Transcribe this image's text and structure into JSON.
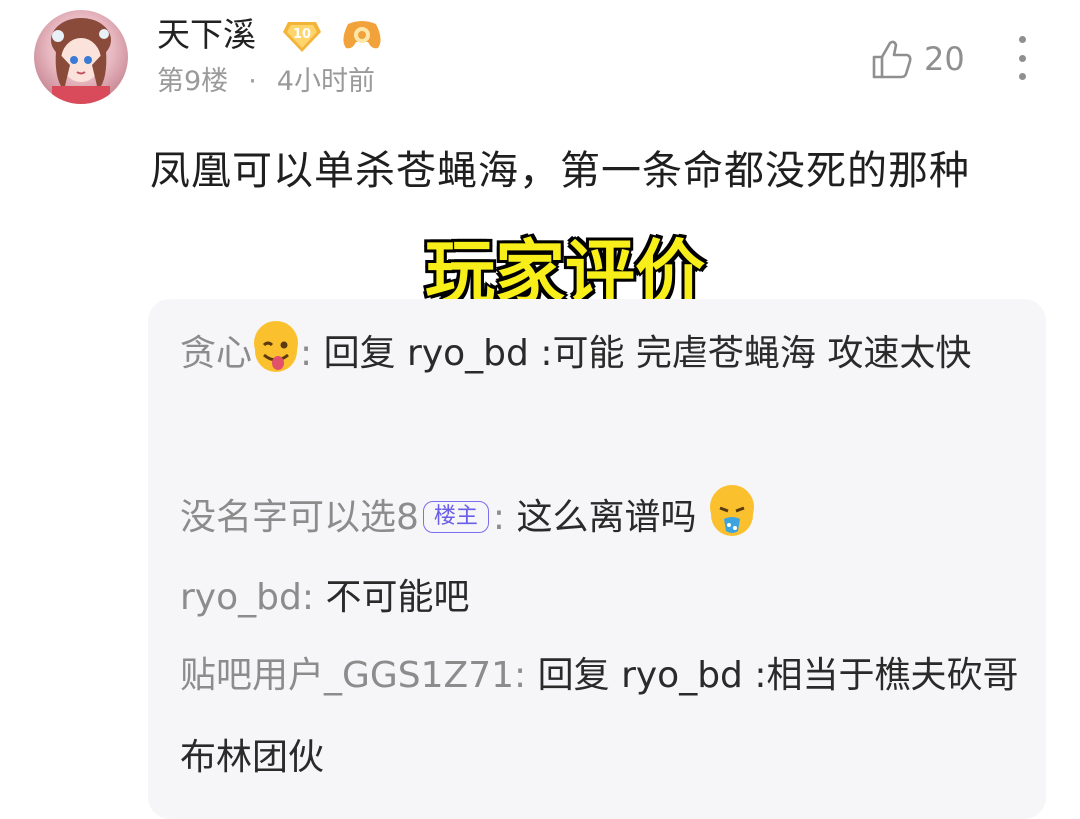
{
  "post": {
    "author": "天下溪",
    "level": "10",
    "floor": "第9楼",
    "separator": "·",
    "time": "4小时前",
    "like_count": "20",
    "content": "凤凰可以单杀苍蝇海，第一条命都没死的那种"
  },
  "overlay_title": "玩家评价",
  "replies": [
    {
      "name": "贪心",
      "sep": ":",
      "text": "回复 ryo_bd :可能 完虐苍蝇海 攻速太快",
      "emoji": "winking-tongue-emoji"
    },
    {
      "name": "没名字可以选8",
      "tag": "楼主",
      "sep": ":",
      "text": "这么离谱吗",
      "emoji": "vomiting-face-emoji"
    },
    {
      "name": "ryo_bd",
      "sep": ":",
      "text": "不可能吧"
    },
    {
      "name": "贴吧用户_GGS1Z71",
      "sep": ":",
      "text": "回复 ryo_bd :相当于樵夫砍哥布林团伙"
    }
  ],
  "colors": {
    "overlay_fill": "#f8ee1a",
    "tag_border": "#7b6ff0",
    "reply_bg": "#f6f6f8",
    "meta_gray": "#9a9a9a"
  }
}
